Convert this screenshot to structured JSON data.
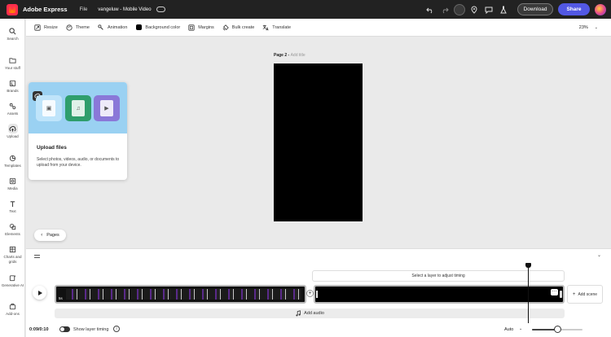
{
  "app": {
    "brand": "Adobe Express",
    "file_menu": "File",
    "doc_title": "vangeluw - Mobile Video",
    "download": "Download",
    "share": "Share"
  },
  "rail": {
    "items": [
      {
        "label": "Search",
        "icon": "search-icon"
      },
      {
        "label": "Your stuff",
        "icon": "folder-icon"
      },
      {
        "label": "Brands",
        "icon": "brand-icon"
      },
      {
        "label": "Assets",
        "icon": "assets-icon"
      },
      {
        "label": "Upload",
        "icon": "upload-icon",
        "active": true
      },
      {
        "label": "Templates",
        "icon": "templates-icon"
      },
      {
        "label": "Media",
        "icon": "media-icon"
      },
      {
        "label": "Text",
        "icon": "text-icon"
      },
      {
        "label": "Elements",
        "icon": "elements-icon"
      },
      {
        "label": "Charts and grids",
        "icon": "charts-icon"
      },
      {
        "label": "Generative AI",
        "icon": "generative-ai-icon"
      },
      {
        "label": "Add-ons",
        "icon": "addons-icon"
      }
    ]
  },
  "toolbar": {
    "resize": "Resize",
    "theme": "Theme",
    "animation": "Animation",
    "background_color": "Background color",
    "margins": "Margins",
    "bulk_create": "Bulk create",
    "translate": "Translate",
    "zoom": "23%"
  },
  "canvas": {
    "page_label": "Page 2 - ",
    "page_title_placeholder": "Add title",
    "background": "#000000"
  },
  "upload_card": {
    "title": "Upload files",
    "description": "Select photos, videos, audio, or documents to upload from your device."
  },
  "pages_button": "Pages",
  "timeline": {
    "hint": "Select a layer to adjust timing",
    "clip1_duration": "5s",
    "add_scene": "Add scene",
    "add_audio": "Add audio",
    "time": "0:09/0:10",
    "show_layer_timing": "Show layer timing",
    "playback": "Auto",
    "zoom_level": 0.5
  },
  "colors": {
    "accent": "#5258e4",
    "topbar": "#222222"
  }
}
